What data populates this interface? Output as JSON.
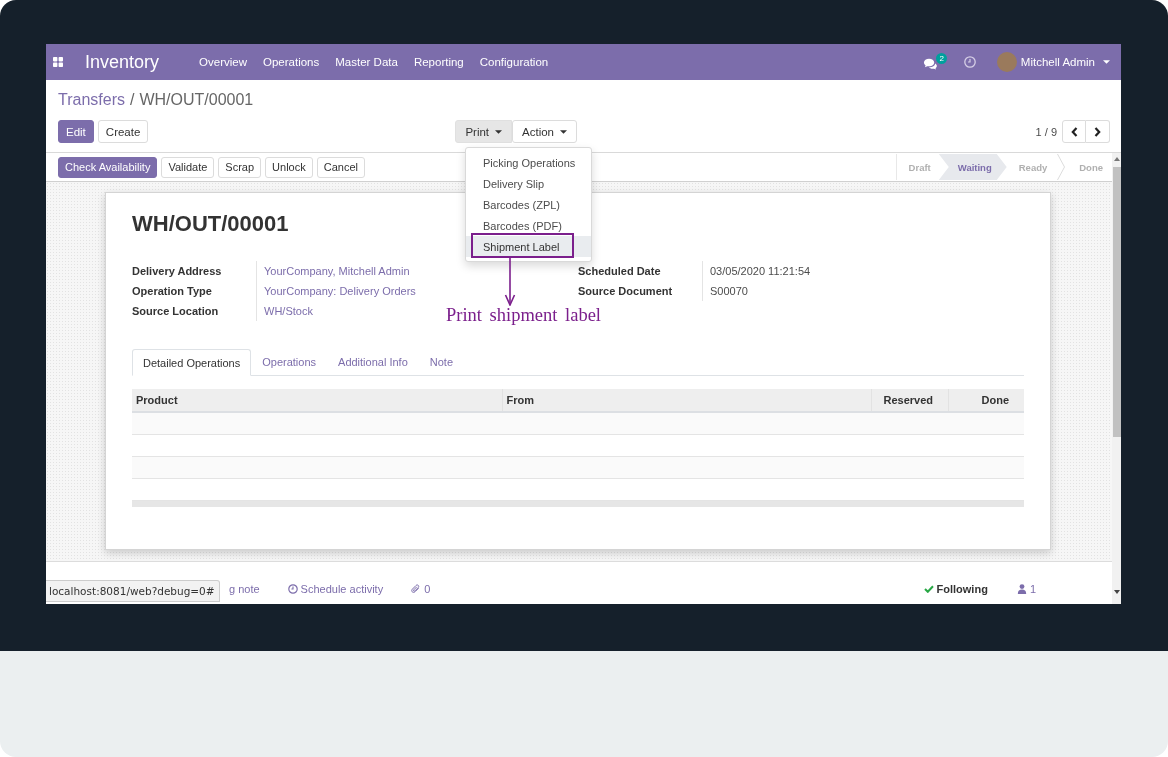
{
  "navbar": {
    "app_name": "Inventory",
    "menu": [
      "Overview",
      "Operations",
      "Master Data",
      "Reporting",
      "Configuration"
    ],
    "message_count": "2",
    "user": "Mitchell Admin"
  },
  "breadcrumb": {
    "parent": "Transfers",
    "separator": "/",
    "current": "WH/OUT/00001"
  },
  "form_buttons": [
    {
      "label": "Edit",
      "primary": true
    },
    {
      "label": "Create",
      "primary": false
    }
  ],
  "print_menu": {
    "label": "Print",
    "open": true,
    "items": [
      {
        "label": "Picking Operations",
        "selected": false
      },
      {
        "label": "Delivery Slip",
        "selected": false
      },
      {
        "label": "Barcodes (ZPL)",
        "selected": false
      },
      {
        "label": "Barcodes (PDF)",
        "selected": false
      },
      {
        "label": "Shipment Label",
        "selected": true
      }
    ]
  },
  "action_menu": {
    "label": "Action"
  },
  "pager": {
    "text": "1 / 9"
  },
  "workflow_buttons": [
    {
      "label": "Check Availability",
      "primary": true
    },
    {
      "label": "Validate",
      "primary": false
    },
    {
      "label": "Scrap",
      "primary": false
    },
    {
      "label": "Unlock",
      "primary": false
    },
    {
      "label": "Cancel",
      "primary": false
    }
  ],
  "stages": [
    {
      "label": "Draft",
      "selected": false
    },
    {
      "label": "Waiting",
      "selected": true
    },
    {
      "label": "Ready",
      "selected": false
    },
    {
      "label": "Done",
      "selected": false
    }
  ],
  "form": {
    "title": "WH/OUT/00001",
    "left_fields": [
      {
        "label": "Delivery Address",
        "value": "YourCompany, Mitchell Admin",
        "kind": "link"
      },
      {
        "label": "Operation Type",
        "value": "YourCompany: Delivery Orders",
        "kind": "link"
      },
      {
        "label": "Source Location",
        "value": "WH/Stock",
        "kind": "link"
      }
    ],
    "right_fields": [
      {
        "label": "Scheduled Date",
        "value": "03/05/2020 11:21:54",
        "kind": "text"
      },
      {
        "label": "Source Document",
        "value": "S00070",
        "kind": "text"
      }
    ],
    "tabs": [
      {
        "label": "Detailed Operations",
        "selected": true
      },
      {
        "label": "Operations",
        "selected": false
      },
      {
        "label": "Additional Info",
        "selected": false
      },
      {
        "label": "Note",
        "selected": false
      }
    ],
    "table": {
      "columns": [
        {
          "label": "Product",
          "kind": "text"
        },
        {
          "label": "From",
          "kind": "text"
        },
        {
          "label": "Reserved",
          "kind": "number"
        },
        {
          "label": "Done",
          "kind": "number"
        }
      ]
    }
  },
  "chatter": {
    "log_note": "g note",
    "schedule_activity": "Schedule activity",
    "attachments": "0",
    "following": "Following",
    "followers": "1"
  },
  "link_tooltip": "localhost:8081/web?debug=0#",
  "annotation": {
    "text": "Print shipment label"
  }
}
